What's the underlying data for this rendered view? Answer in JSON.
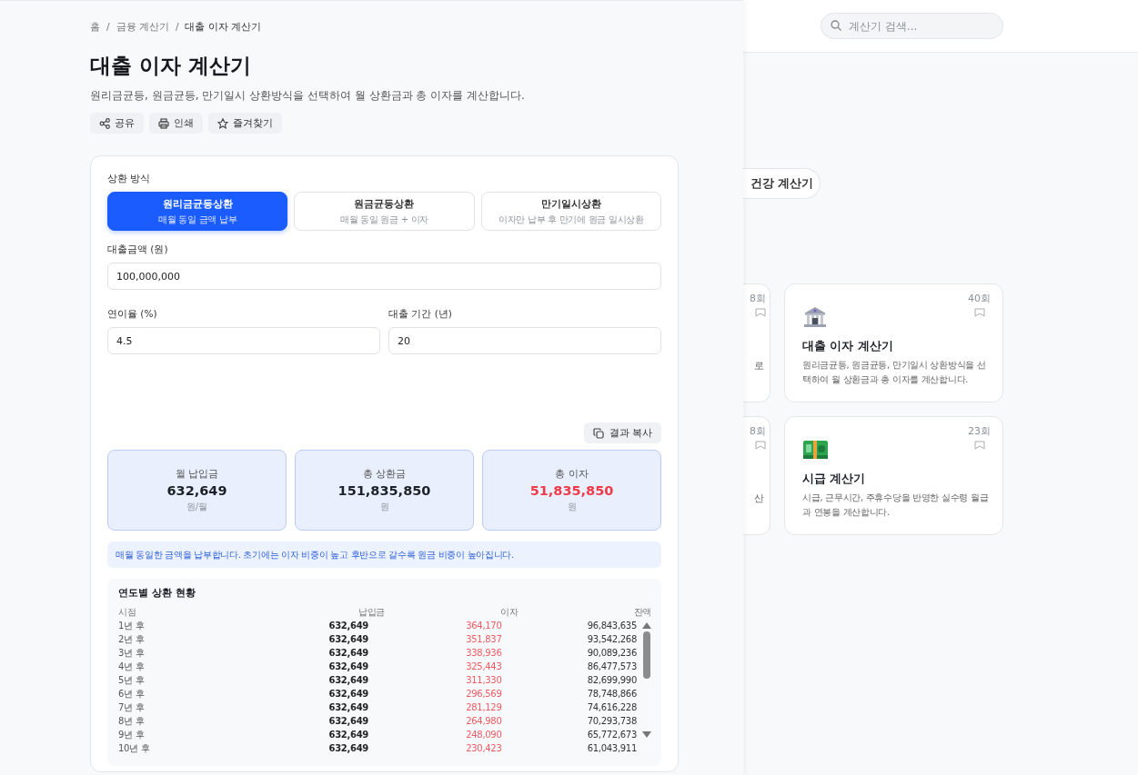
{
  "background_page": {
    "search": {
      "placeholder": "계산기 검색..."
    },
    "category_chip": {
      "label": "건강 계산기"
    },
    "partial_cards": [
      {
        "count": "8회",
        "description": "로"
      },
      {
        "count": "8회",
        "description": "산"
      }
    ],
    "cards": [
      {
        "kind": "bank",
        "count": "40회",
        "title": "대출 이자 계산기",
        "description": "원리금균등, 원금균등, 만기일시 상환방식을 선택하여 월 상환금과 총 이자를 계산합니다."
      },
      {
        "kind": "money",
        "count": "23회",
        "title": "시급 계산기",
        "description": "시급, 근무시간, 주휴수당을 반영한 실수령 월급과 연봉을 계산합니다."
      }
    ]
  },
  "panel": {
    "breadcrumb": [
      {
        "kind": "link",
        "text": "홈"
      },
      {
        "kind": "separator",
        "text": "/"
      },
      {
        "kind": "link",
        "text": "금융 계산기"
      },
      {
        "kind": "separator",
        "text": "/"
      },
      {
        "kind": "current",
        "text": "대출 이자 계산기"
      }
    ],
    "title": "대출 이자 계산기",
    "description": "원리금균등, 원금균등, 만기일시 상환방식을 선택하여 월 상환금과 총 이자를 계산합니다.",
    "actions": [
      {
        "kind": "share",
        "label": "공유"
      },
      {
        "kind": "print",
        "label": "인쇄"
      },
      {
        "kind": "favorite",
        "label": "즐겨찾기"
      }
    ],
    "method_label": "상환 방식",
    "methods": [
      {
        "title": "원리금균등상환",
        "subtitle": "매월 동일 금액 납부",
        "selected": true
      },
      {
        "title": "원금균등상환",
        "subtitle": "매월 동일 원금 + 이자",
        "selected": false
      },
      {
        "title": "만기일시상환",
        "subtitle": "이자만 납부 후 만기에 원금 일시상환",
        "selected": false
      }
    ],
    "loan_amount": {
      "label": "대출금액 (원)",
      "value": "100,000,000"
    },
    "interest_rate": {
      "label": "연이율 (%)",
      "value": "4.5"
    },
    "loan_term": {
      "label": "대출 기간 (년)",
      "value": "20"
    },
    "copy_button": {
      "label": "결과 복사"
    },
    "results": [
      {
        "label": "월 납입금",
        "value": "632,649",
        "unit": "원/월",
        "highlight": false
      },
      {
        "label": "총 상환금",
        "value": "151,835,850",
        "unit": "원",
        "highlight": false
      },
      {
        "label": "총 이자",
        "value": "51,835,850",
        "unit": "원",
        "highlight": true
      }
    ],
    "note": "매월 동일한 금액을 납부합니다. 초기에는 이자 비중이 높고 후반으로 갈수록 원금 비중이 높아집니다.",
    "schedule": {
      "title": "연도별 상환 현황",
      "columns": [
        "시점",
        "납입금",
        "이자",
        "잔액"
      ],
      "rows": [
        [
          "1년 후",
          "632,649",
          "364,170",
          "96,843,635"
        ],
        [
          "2년 후",
          "632,649",
          "351,837",
          "93,542,268"
        ],
        [
          "3년 후",
          "632,649",
          "338,936",
          "90,089,236"
        ],
        [
          "4년 후",
          "632,649",
          "325,443",
          "86,477,573"
        ],
        [
          "5년 후",
          "632,649",
          "311,330",
          "82,699,990"
        ],
        [
          "6년 후",
          "632,649",
          "296,569",
          "78,748,866"
        ],
        [
          "7년 후",
          "632,649",
          "281,129",
          "74,616,228"
        ],
        [
          "8년 후",
          "632,649",
          "264,980",
          "70,293,738"
        ],
        [
          "9년 후",
          "632,649",
          "248,090",
          "65,772,673"
        ],
        [
          "10년 후",
          "632,649",
          "230,423",
          "61,043,911"
        ]
      ]
    }
  }
}
